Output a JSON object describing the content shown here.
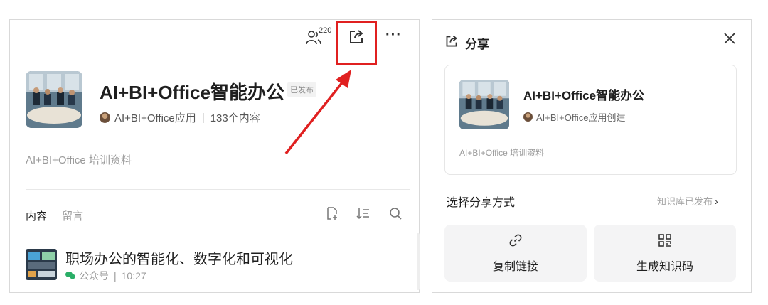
{
  "left": {
    "member_count": "220",
    "kb": {
      "title": "AI+BI+Office智能办公",
      "status": "已发布",
      "owner": "AI+BI+Office应用",
      "content_count": "133个内容",
      "description": "AI+BI+Office 培训资料"
    },
    "tabs": {
      "content": "内容",
      "comments": "留言"
    },
    "list": [
      {
        "title": "职场办公的智能化、数字化和可视化",
        "source": "公众号",
        "time": "10:27"
      }
    ]
  },
  "share": {
    "title": "分享",
    "card": {
      "title": "AI+BI+Office智能办公",
      "creator": "AI+BI+Office应用创建",
      "description": "AI+BI+Office 培训资料"
    },
    "choose_label": "选择分享方式",
    "publish_status": "知识库已发布",
    "actions": {
      "copy_link": "复制链接",
      "qr_code": "生成知识码"
    }
  },
  "colors": {
    "highlight": "#e02020",
    "wechat": "#2aae67",
    "muted": "#9a9a9a"
  }
}
